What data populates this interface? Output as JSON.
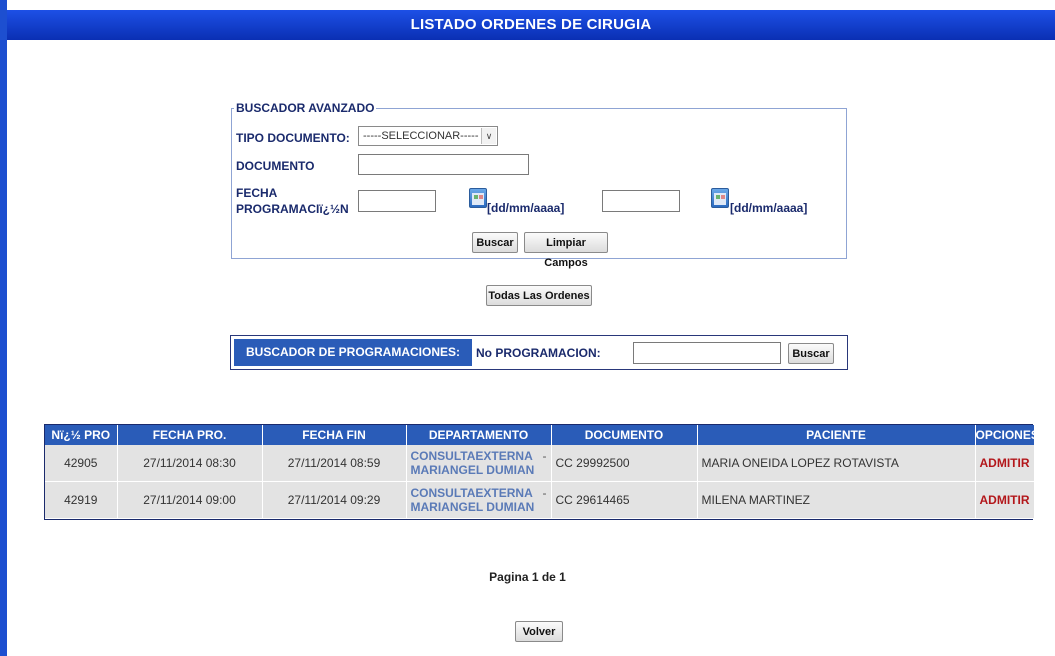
{
  "title": "LISTADO ORDENES DE CIRUGIA",
  "advanced_search": {
    "legend": "BUSCADOR AVANZADO",
    "doc_type_label": "TIPO DOCUMENTO:",
    "doc_type_value": "-----SELECCIONAR-----",
    "document_label": "DOCUMENTO",
    "document_value": "",
    "date_label_1": "FECHA",
    "date_label_2": "PROGRAMACIï¿½N",
    "date_from_value": "",
    "date_to_value": "",
    "date_format": "[dd/mm/aaaa]",
    "search_button": "Buscar",
    "clear_button": "Limpiar Campos"
  },
  "all_orders_button": "Todas Las Ordenes",
  "prog_search": {
    "heading": "BUSCADOR DE PROGRAMACIONES:",
    "field_label": "No PROGRAMACION:",
    "field_value": "",
    "button": "Buscar"
  },
  "table": {
    "headers": [
      "Nï¿½ PRO",
      "FECHA PRO.",
      "FECHA FIN",
      "DEPARTAMENTO",
      "DOCUMENTO",
      "PACIENTE",
      "OPCIONES"
    ],
    "rows": [
      {
        "num": "42905",
        "fecha_pro": "27/11/2014 08:30",
        "fecha_fin": "27/11/2014 08:59",
        "dept_word1": "CONSULTA",
        "dept_word2": "EXTERNA",
        "dept_line2": "MARIANGEL DUMIAN",
        "dept_dash": "-",
        "documento": "CC 29992500",
        "paciente": "MARIA ONEIDA LOPEZ ROTAVISTA",
        "opcion": "ADMITIR"
      },
      {
        "num": "42919",
        "fecha_pro": "27/11/2014 09:00",
        "fecha_fin": "27/11/2014 09:29",
        "dept_word1": "CONSULTA",
        "dept_word2": "EXTERNA",
        "dept_line2": "MARIANGEL DUMIAN",
        "dept_dash": "-",
        "documento": "CC 29614465",
        "paciente": "MILENA MARTINEZ",
        "opcion": "ADMITIR"
      }
    ]
  },
  "pagination": "Pagina 1 de 1",
  "back_button": "Volver",
  "colors": {
    "title_bar": "#1d50e6",
    "header_blue": "#2a5cb8",
    "label_text": "#1a2a6c",
    "row_bg": "#e3e3e3",
    "admit_red": "#b3171b"
  }
}
